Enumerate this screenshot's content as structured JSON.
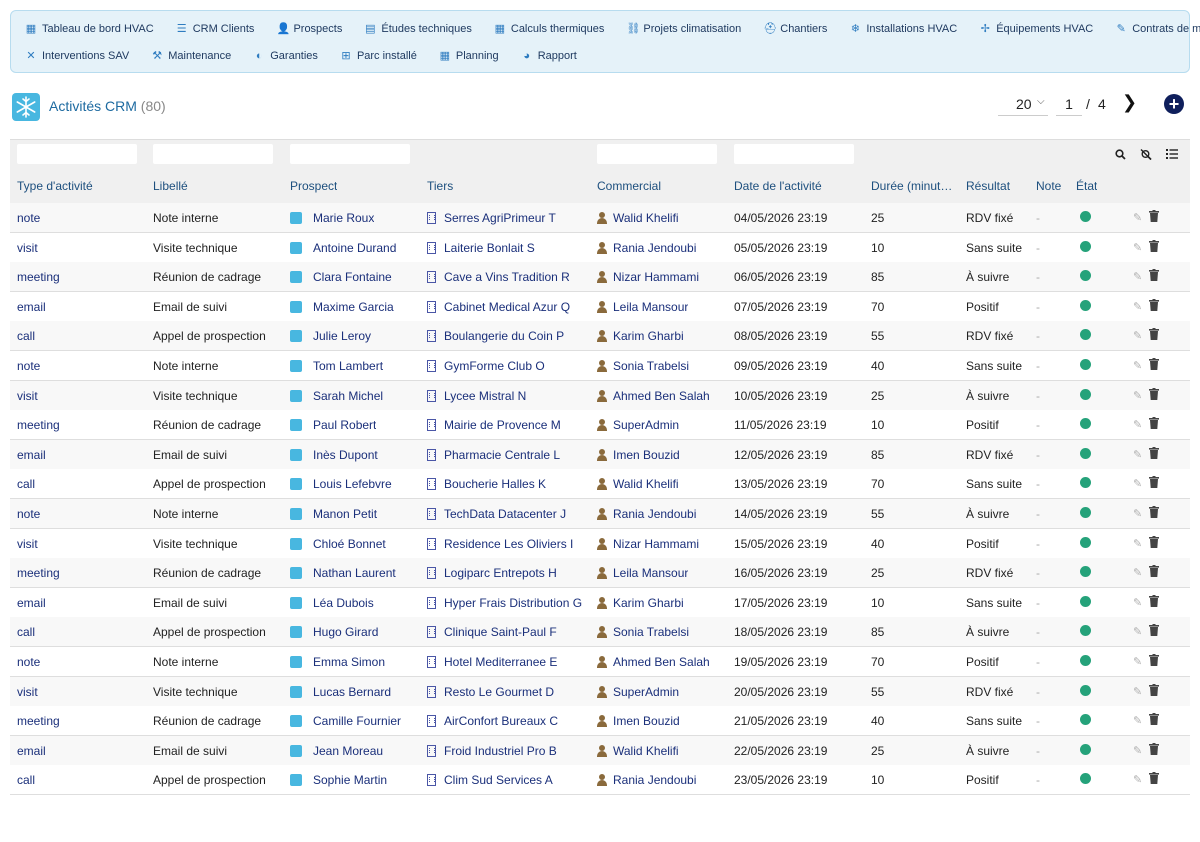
{
  "nav": {
    "row1": [
      {
        "label": "Tableau de bord HVAC",
        "icon": "dashboard-icon",
        "glyph": "▦"
      },
      {
        "label": "CRM Clients",
        "icon": "list-icon",
        "glyph": "☰"
      },
      {
        "label": "Prospects",
        "icon": "user-plus-icon",
        "glyph": "👤"
      },
      {
        "label": "Études techniques",
        "icon": "document-icon",
        "glyph": "▤"
      },
      {
        "label": "Calculs thermiques",
        "icon": "calculator-icon",
        "glyph": "▦"
      },
      {
        "label": "Projets climatisation",
        "icon": "project-tree-icon",
        "glyph": "⛓"
      },
      {
        "label": "Chantiers",
        "icon": "hard-hat-icon",
        "glyph": "⛑"
      },
      {
        "label": "Installations HVAC",
        "icon": "snowflake-icon",
        "glyph": "❄"
      },
      {
        "label": "Équipements HVAC",
        "icon": "fan-icon",
        "glyph": "✢"
      },
      {
        "label": "Contrats de maintenance",
        "icon": "contract-icon",
        "glyph": "✎"
      }
    ],
    "row2": [
      {
        "label": "Interventions SAV",
        "icon": "tools-icon",
        "glyph": "✕"
      },
      {
        "label": "Maintenance",
        "icon": "wrench-icon",
        "glyph": "⚒"
      },
      {
        "label": "Garanties",
        "icon": "shield-icon",
        "glyph": "◐"
      },
      {
        "label": "Parc installé",
        "icon": "sitemap-icon",
        "glyph": "⊞"
      },
      {
        "label": "Planning",
        "icon": "calendar-icon",
        "glyph": "▦"
      },
      {
        "label": "Rapport",
        "icon": "pie-chart-icon",
        "glyph": "◕"
      }
    ]
  },
  "page": {
    "title": "Activités CRM",
    "count": "(80)"
  },
  "pagination": {
    "limit": "20",
    "page": "1",
    "separator": "/",
    "total": "4",
    "next_glyph": "❯",
    "add_glyph": "+"
  },
  "table": {
    "headers": [
      "Type d'activité",
      "Libellé",
      "Prospect",
      "Tiers",
      "Commercial",
      "Date de l'activité",
      "Durée (minut…",
      "Résultat",
      "Note",
      "État"
    ],
    "status_color": "#25a27a",
    "rows": [
      {
        "type": "note",
        "label": "Note interne",
        "prospect": "Marie Roux",
        "tiers": "Serres AgriPrimeur T",
        "commercial": "Walid Khelifi",
        "date": "04/05/2026 23:19",
        "duration": "25",
        "result": "RDV fixé",
        "note": "-"
      },
      {
        "type": "visit",
        "label": "Visite technique",
        "prospect": "Antoine Durand",
        "tiers": "Laiterie Bonlait S",
        "commercial": "Rania Jendoubi",
        "date": "05/05/2026 23:19",
        "duration": "10",
        "result": "Sans suite",
        "note": "-"
      },
      {
        "type": "meeting",
        "label": "Réunion de cadrage",
        "prospect": "Clara Fontaine",
        "tiers": "Cave a Vins Tradition R",
        "commercial": "Nizar Hammami",
        "date": "06/05/2026 23:19",
        "duration": "85",
        "result": "À suivre",
        "note": "-"
      },
      {
        "type": "email",
        "label": "Email de suivi",
        "prospect": "Maxime Garcia",
        "tiers": "Cabinet Medical Azur Q",
        "commercial": "Leila Mansour",
        "date": "07/05/2026 23:19",
        "duration": "70",
        "result": "Positif",
        "note": "-"
      },
      {
        "type": "call",
        "label": "Appel de prospection",
        "prospect": "Julie Leroy",
        "tiers": "Boulangerie du Coin P",
        "commercial": "Karim Gharbi",
        "date": "08/05/2026 23:19",
        "duration": "55",
        "result": "RDV fixé",
        "note": "-"
      },
      {
        "type": "note",
        "label": "Note interne",
        "prospect": "Tom Lambert",
        "tiers": "GymForme Club O",
        "commercial": "Sonia Trabelsi",
        "date": "09/05/2026 23:19",
        "duration": "40",
        "result": "Sans suite",
        "note": "-"
      },
      {
        "type": "visit",
        "label": "Visite technique",
        "prospect": "Sarah Michel",
        "tiers": "Lycee Mistral N",
        "commercial": "Ahmed Ben Salah",
        "date": "10/05/2026 23:19",
        "duration": "25",
        "result": "À suivre",
        "note": "-"
      },
      {
        "type": "meeting",
        "label": "Réunion de cadrage",
        "prospect": "Paul Robert",
        "tiers": "Mairie de Provence M",
        "commercial": "SuperAdmin",
        "date": "11/05/2026 23:19",
        "duration": "10",
        "result": "Positif",
        "note": "-"
      },
      {
        "type": "email",
        "label": "Email de suivi",
        "prospect": "Inès Dupont",
        "tiers": "Pharmacie Centrale L",
        "commercial": "Imen Bouzid",
        "date": "12/05/2026 23:19",
        "duration": "85",
        "result": "RDV fixé",
        "note": "-"
      },
      {
        "type": "call",
        "label": "Appel de prospection",
        "prospect": "Louis Lefebvre",
        "tiers": "Boucherie Halles K",
        "commercial": "Walid Khelifi",
        "date": "13/05/2026 23:19",
        "duration": "70",
        "result": "Sans suite",
        "note": "-"
      },
      {
        "type": "note",
        "label": "Note interne",
        "prospect": "Manon Petit",
        "tiers": "TechData Datacenter J",
        "commercial": "Rania Jendoubi",
        "date": "14/05/2026 23:19",
        "duration": "55",
        "result": "À suivre",
        "note": "-"
      },
      {
        "type": "visit",
        "label": "Visite technique",
        "prospect": "Chloé Bonnet",
        "tiers": "Residence Les Oliviers I",
        "commercial": "Nizar Hammami",
        "date": "15/05/2026 23:19",
        "duration": "40",
        "result": "Positif",
        "note": "-"
      },
      {
        "type": "meeting",
        "label": "Réunion de cadrage",
        "prospect": "Nathan Laurent",
        "tiers": "Logiparc Entrepots H",
        "commercial": "Leila Mansour",
        "date": "16/05/2026 23:19",
        "duration": "25",
        "result": "RDV fixé",
        "note": "-"
      },
      {
        "type": "email",
        "label": "Email de suivi",
        "prospect": "Léa Dubois",
        "tiers": "Hyper Frais Distribution G",
        "commercial": "Karim Gharbi",
        "date": "17/05/2026 23:19",
        "duration": "10",
        "result": "Sans suite",
        "note": "-"
      },
      {
        "type": "call",
        "label": "Appel de prospection",
        "prospect": "Hugo Girard",
        "tiers": "Clinique Saint-Paul F",
        "commercial": "Sonia Trabelsi",
        "date": "18/05/2026 23:19",
        "duration": "85",
        "result": "À suivre",
        "note": "-"
      },
      {
        "type": "note",
        "label": "Note interne",
        "prospect": "Emma Simon",
        "tiers": "Hotel Mediterranee E",
        "commercial": "Ahmed Ben Salah",
        "date": "19/05/2026 23:19",
        "duration": "70",
        "result": "Positif",
        "note": "-"
      },
      {
        "type": "visit",
        "label": "Visite technique",
        "prospect": "Lucas Bernard",
        "tiers": "Resto Le Gourmet D",
        "commercial": "SuperAdmin",
        "date": "20/05/2026 23:19",
        "duration": "55",
        "result": "RDV fixé",
        "note": "-"
      },
      {
        "type": "meeting",
        "label": "Réunion de cadrage",
        "prospect": "Camille Fournier",
        "tiers": "AirConfort Bureaux C",
        "commercial": "Imen Bouzid",
        "date": "21/05/2026 23:19",
        "duration": "40",
        "result": "Sans suite",
        "note": "-"
      },
      {
        "type": "email",
        "label": "Email de suivi",
        "prospect": "Jean Moreau",
        "tiers": "Froid Industriel Pro B",
        "commercial": "Walid Khelifi",
        "date": "22/05/2026 23:19",
        "duration": "25",
        "result": "À suivre",
        "note": "-"
      },
      {
        "type": "call",
        "label": "Appel de prospection",
        "prospect": "Sophie Martin",
        "tiers": "Clim Sud Services A",
        "commercial": "Rania Jendoubi",
        "date": "23/05/2026 23:19",
        "duration": "10",
        "result": "Positif",
        "note": "-"
      }
    ]
  }
}
